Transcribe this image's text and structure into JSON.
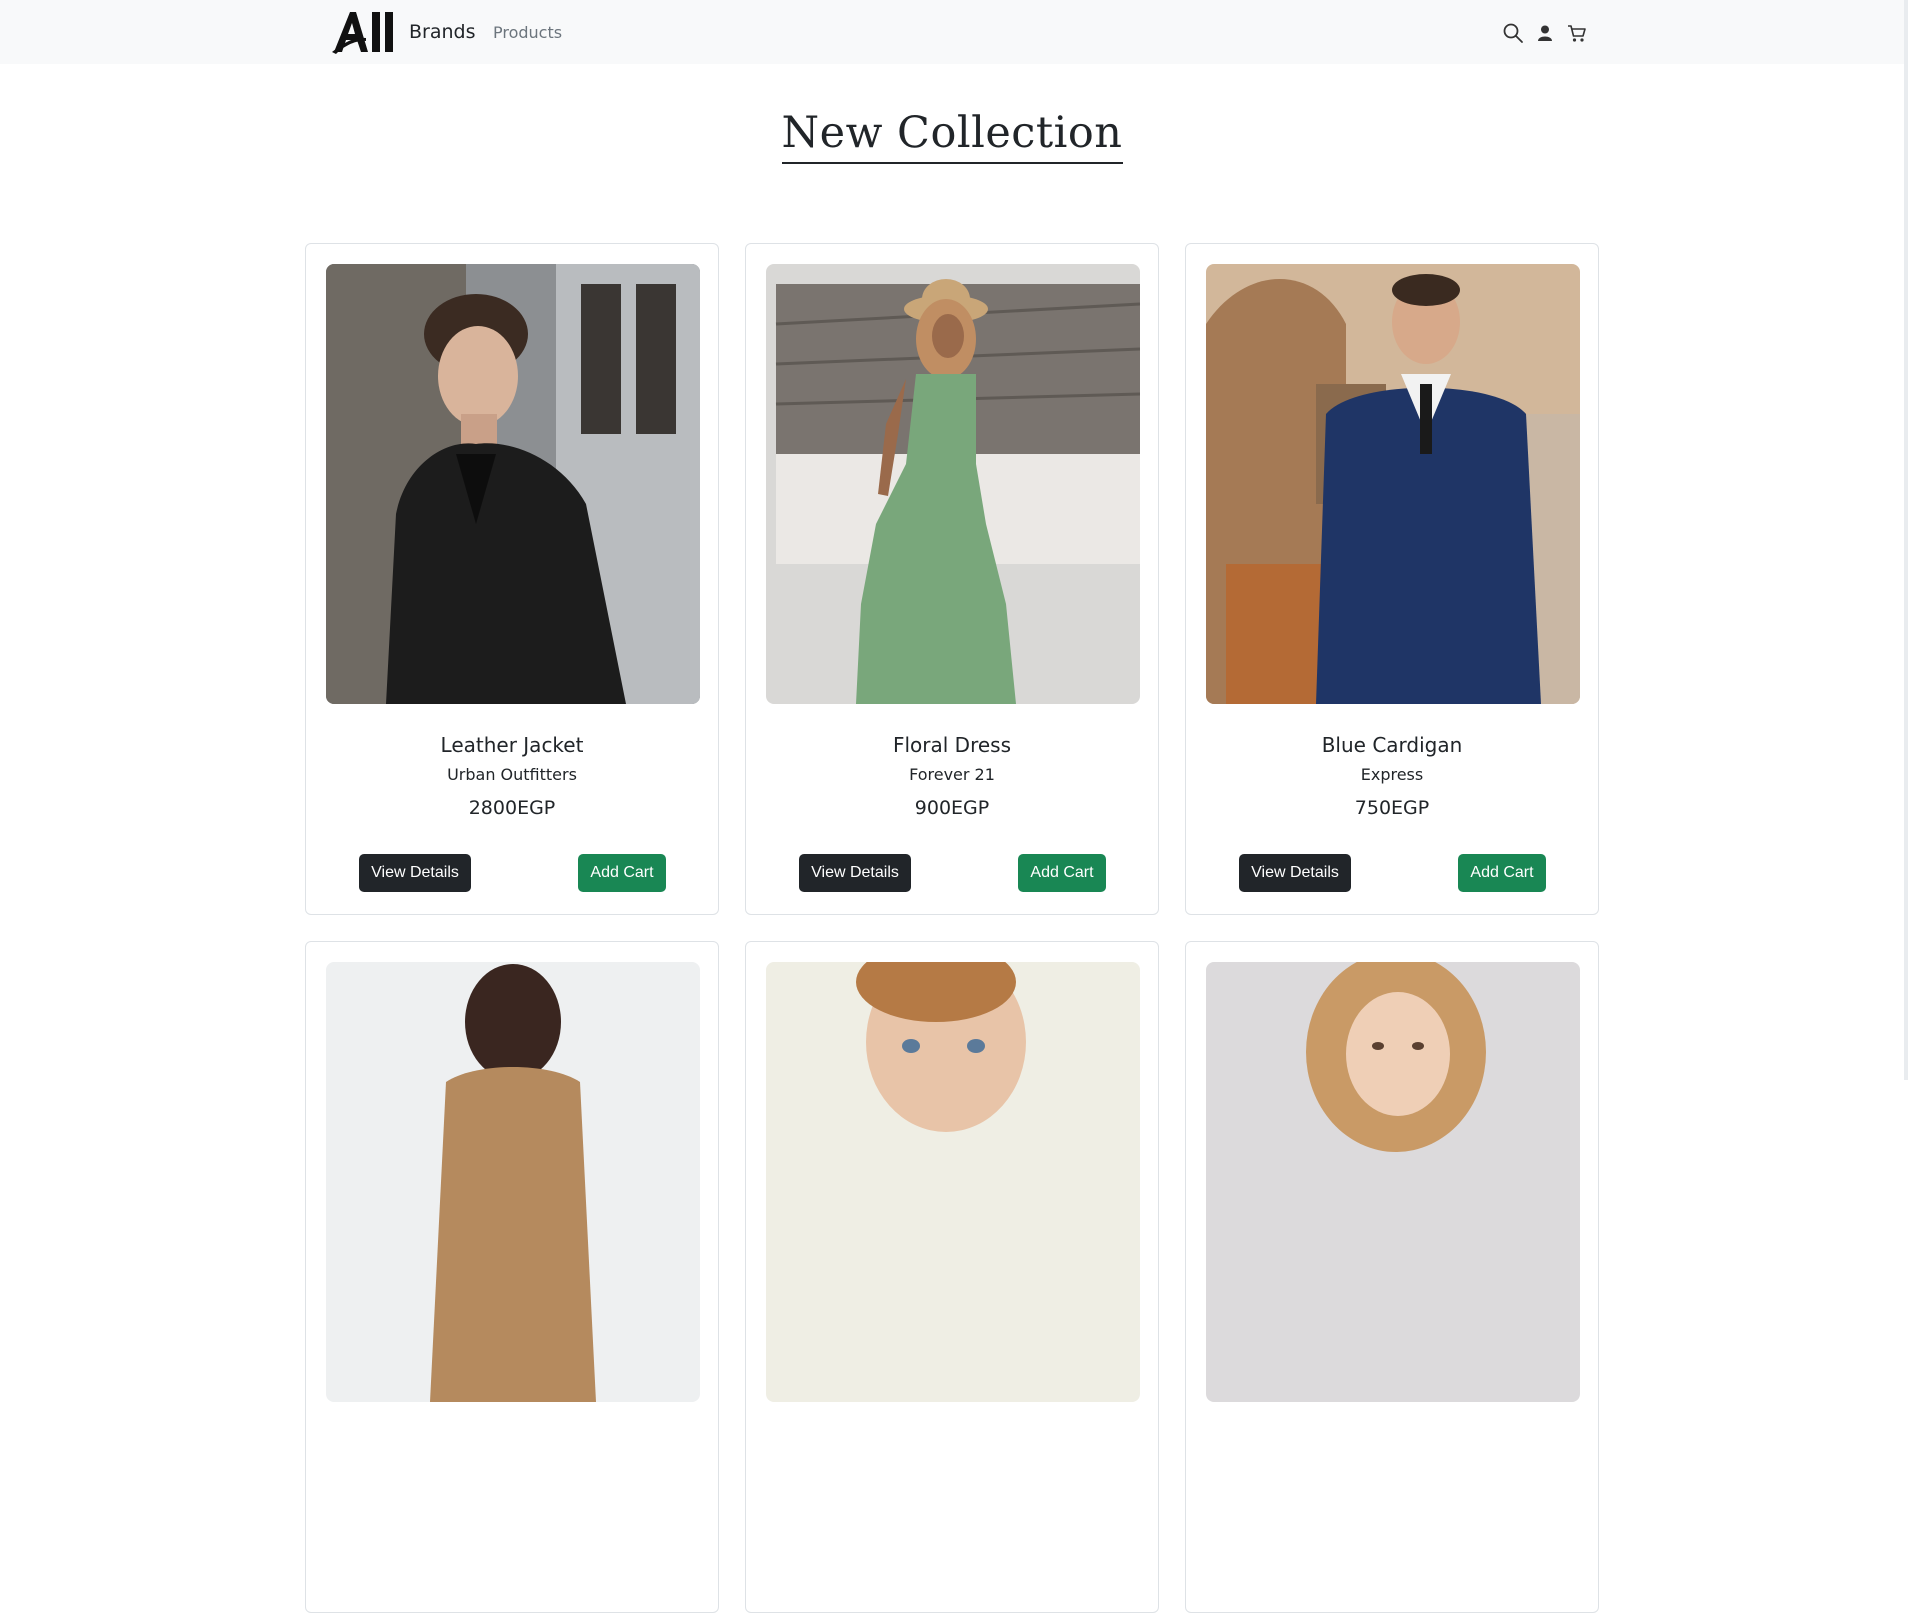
{
  "navbar": {
    "logo_text": "All",
    "links": [
      {
        "label": "Brands"
      },
      {
        "label": "Products"
      }
    ],
    "icons": [
      "search-icon",
      "user-icon",
      "cart-icon"
    ]
  },
  "section": {
    "title": "New Collection"
  },
  "products": [
    {
      "title": "Leather Jacket",
      "brand": "Urban Outfitters",
      "price": "2800EGP",
      "details_label": "View Details",
      "cart_label": "Add Cart"
    },
    {
      "title": "Floral Dress",
      "brand": "Forever 21",
      "price": "900EGP",
      "details_label": "View Details",
      "cart_label": "Add Cart"
    },
    {
      "title": "Blue Cardigan",
      "brand": "Express",
      "price": "750EGP",
      "details_label": "View Details",
      "cart_label": "Add Cart"
    },
    {
      "title": "",
      "brand": "",
      "price": "",
      "details_label": "",
      "cart_label": ""
    },
    {
      "title": "",
      "brand": "",
      "price": "",
      "details_label": "",
      "cart_label": ""
    },
    {
      "title": "",
      "brand": "",
      "price": "",
      "details_label": "",
      "cart_label": ""
    }
  ],
  "colors": {
    "navbar_bg": "#f8f9fa",
    "dark_button": "#212529",
    "green_button": "#198754"
  }
}
